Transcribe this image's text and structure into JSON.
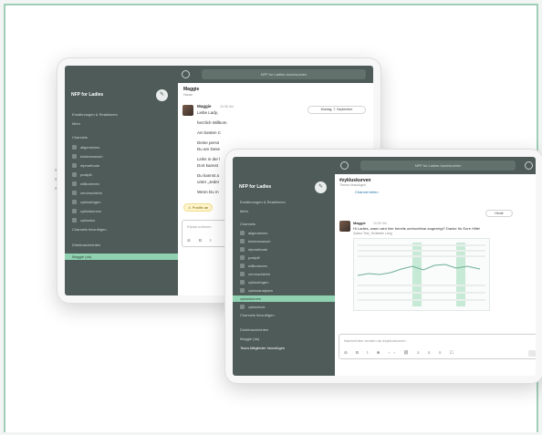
{
  "back": {
    "search_placeholder": "NFP for Ladies durchsuchen",
    "workspace": "NFP for Ladies",
    "nav": [
      "Erwähnungen & Reaktionen",
      "Mehr"
    ],
    "channels_header": "Channels",
    "channels": [
      "allgemeines",
      "kinderwunsch",
      "nfpmethode",
      "postpill",
      "willkommen",
      "zervixschleim",
      "zyklusfragen",
      "zykluskurven",
      "zykluslos"
    ],
    "add_channel": "Channels hinzufügen",
    "dm_header": "Direktnachrichten",
    "dm_user": "Maggie (du)",
    "channel_title": "Maggie",
    "channel_sub": "Hause",
    "msg_author": "Maggie",
    "msg_time": "10:36 Uhr",
    "date_pill": "Montag, 7. September",
    "lines": [
      "Liebe Lady,",
      "herzlich Willkom",
      "Am besten C",
      "Deine persö",
      "Du am Dese",
      "Links in der l",
      "Dort kannst",
      "Du kannst a",
      "unter „Jeder",
      "Wenn Du m"
    ],
    "notification": "Postfix an",
    "input_placeholder": "Etwas notieren"
  },
  "front": {
    "search_placeholder": "NFP for Ladies durchsuchen",
    "workspace": "NFP for Ladies",
    "nav": [
      "Erwähnungen & Reaktionen",
      "Mehr"
    ],
    "channels_header": "Channels",
    "channels": [
      "allgemeines",
      "kinderwunsch",
      "nfpmethode",
      "postpill",
      "willkommen",
      "zervixschleim",
      "zyklusfragen",
      "zyklusanalysen",
      "zykluskurven",
      "zykluslook"
    ],
    "active_channel": "zykluskurven",
    "add_channel": "Channels hinzufügen",
    "dm_header": "Direktnachrichten",
    "dm_user": "Maggie (du)",
    "add_member": "Team-Mitglieder hinzufügen",
    "channel_title": "#zykluskurven",
    "channel_sub": "Thema hinzufügen",
    "channel_link": "Channel teilen",
    "date_pill": "Heute",
    "msg_author": "Maggie",
    "msg_time": "10:59 Uhr",
    "msg_text": "Hi Ladies, wann wird hier bereits umfruchtbar angezeigt? Danke für Eure Hilfe!",
    "msg_sub": "Zyklus Test_Textstelle Lang",
    "input_placeholder": "Nachrichten senden an #zykluskurven"
  },
  "icons": [
    "clock-icon",
    "help-icon",
    "compose-icon",
    "hash-icon",
    "star-icon"
  ],
  "colors": {
    "sidebar": "#4e5b58",
    "active": "#8fd1b0",
    "frame": "#9fcfb6"
  }
}
